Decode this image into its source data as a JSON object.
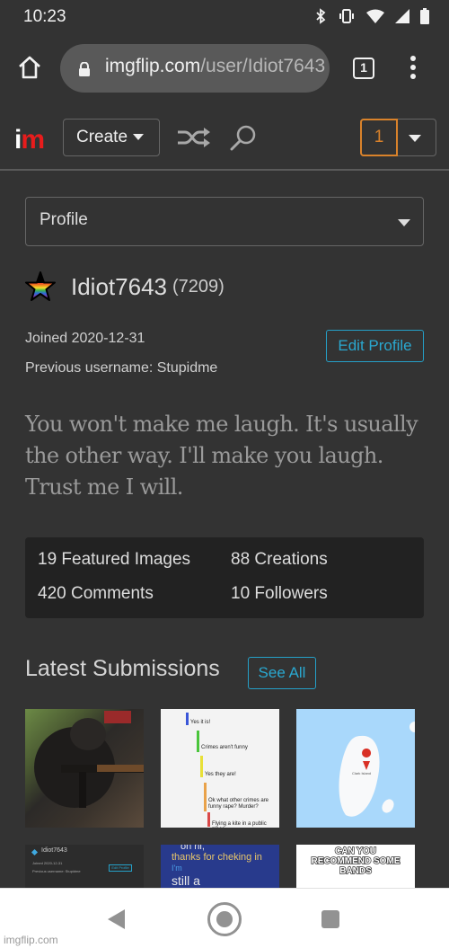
{
  "status_bar": {
    "time": "10:23",
    "icons": [
      "bluetooth-icon",
      "vibrate-icon",
      "wifi-icon",
      "signal-icon",
      "battery-icon"
    ]
  },
  "browser": {
    "url_domain": "imgflip.com",
    "url_path": "/user/Idiot7643",
    "tab_count": "1"
  },
  "site_header": {
    "logo_i": "i",
    "logo_m": "m",
    "create_label": "Create",
    "notification_count": "1",
    "brand_colors": {
      "logo_red": "#e81c1c",
      "notification_orange": "#d9822b",
      "link_blue": "#2aa8d0"
    }
  },
  "profile": {
    "section_select": "Profile",
    "username": "Idiot7643",
    "points": "(7209)",
    "joined": "Joined 2020-12-31",
    "previous_username": "Previous username: Stupidme",
    "edit_profile_label": "Edit Profile",
    "bio": "You won't make me laugh. It's usually the other way. I'll make you laugh. Trust me I will.",
    "stats": [
      {
        "label": "19 Featured Images"
      },
      {
        "label": "88 Creations"
      },
      {
        "label": "420 Comments"
      },
      {
        "label": "10 Followers"
      }
    ]
  },
  "latest_submissions": {
    "title": "Latest Submissions",
    "see_all_label": "See All",
    "thumbnails": [
      {
        "description": "chimpanzee holding rifle"
      },
      {
        "description": "comment thread screenshot",
        "lines": [
          "Yes it is!",
          "Crimes aren't funny",
          "Yes they are!",
          "Ok what other crimes are funny rape? Murder?",
          "Flying a kite in a public place."
        ]
      },
      {
        "description": "map of island",
        "pin_label": "Clark Island"
      },
      {
        "description": "profile screenshot"
      },
      {
        "description": "text meme",
        "lines": [
          "oh hi,",
          "thanks for cheking in",
          "I'm",
          "still a"
        ]
      },
      {
        "description": "text meme",
        "lines": [
          "CAN YOU",
          "RECOMMEND SOME BANDS"
        ]
      }
    ]
  },
  "watermark": "imgflip.com"
}
